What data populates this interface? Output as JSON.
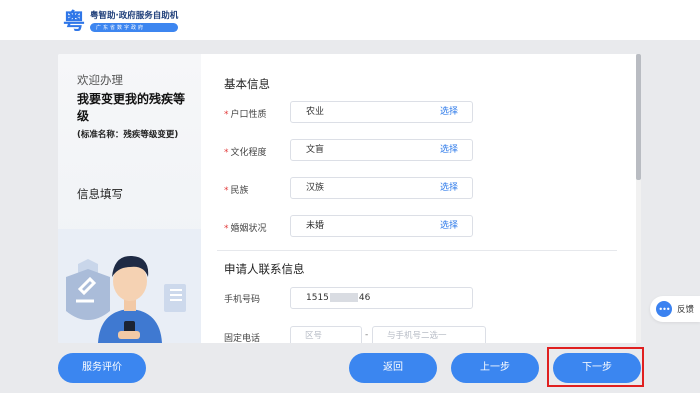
{
  "header": {
    "logo_glyph": "粤",
    "logo_title": "粤智助·政府服务自助机",
    "logo_subtitle": "广东省数字政府"
  },
  "left_panel": {
    "welcome": "欢迎办理",
    "service_title": "我要变更我的残疾等级",
    "standard_name": "(标准名称：残疾等级变更)",
    "current_step": "信息填写"
  },
  "form": {
    "basic_section": "基本信息",
    "select_label": "选择",
    "fields": [
      {
        "label": "户口性质",
        "value": "农业",
        "required": true
      },
      {
        "label": "文化程度",
        "value": "文盲",
        "required": true
      },
      {
        "label": "民族",
        "value": "汉族",
        "required": true
      },
      {
        "label": "婚姻状况",
        "value": "未婚",
        "required": true
      }
    ],
    "contact_section": "申请人联系信息",
    "phone_label": "手机号码",
    "phone_value": "1515",
    "phone_value_tail": "46",
    "landline_label": "固定电话",
    "area_code_placeholder": "区号",
    "landline_placeholder": "与手机号二选一",
    "dash": "-"
  },
  "feedback": {
    "icon_text": "•••",
    "label": "反馈"
  },
  "buttons": {
    "rate": "服务评价",
    "back": "返回",
    "prev": "上一步",
    "next": "下一步"
  },
  "colors": {
    "accent": "#3b86f0",
    "required": "#e23b3b",
    "highlight_border": "#e02020"
  }
}
